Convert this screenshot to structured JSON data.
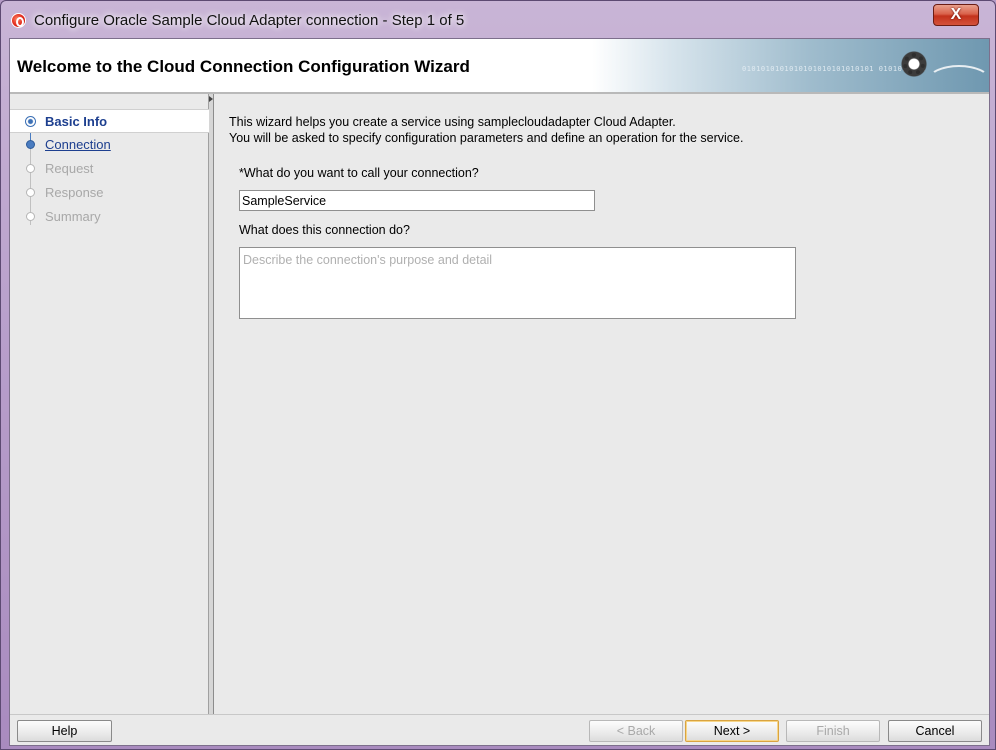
{
  "window": {
    "title": "Configure Oracle Sample Cloud Adapter connection - Step 1 of 5",
    "close_label": "X"
  },
  "header": {
    "title": "Welcome to the Cloud Connection Configuration Wizard",
    "banner_binary": "0101010101010101010101010101 0101010101"
  },
  "steps": [
    {
      "label": "Basic Info",
      "state": "active"
    },
    {
      "label": "Connection",
      "state": "done"
    },
    {
      "label": "Request",
      "state": "todo"
    },
    {
      "label": "Response",
      "state": "todo"
    },
    {
      "label": "Summary",
      "state": "todo"
    }
  ],
  "content": {
    "intro_line1": "This wizard helps you create a service using samplecloudadapter Cloud Adapter.",
    "intro_line2": "You will be asked to specify configuration parameters and define an operation for the service.",
    "name_question": "*What do you want to call your connection?",
    "name_value": "SampleService",
    "desc_question": "What does this connection do?",
    "desc_placeholder": "Describe the connection's purpose and detail"
  },
  "footer": {
    "help_label": "Help",
    "back_label": "< Back",
    "next_label": "Next >",
    "finish_label": "Finish",
    "cancel_label": "Cancel"
  },
  "colors": {
    "accent": "#1d3f8f",
    "step_done": "#4a7cc0",
    "step_todo": "#a8a8a8"
  }
}
